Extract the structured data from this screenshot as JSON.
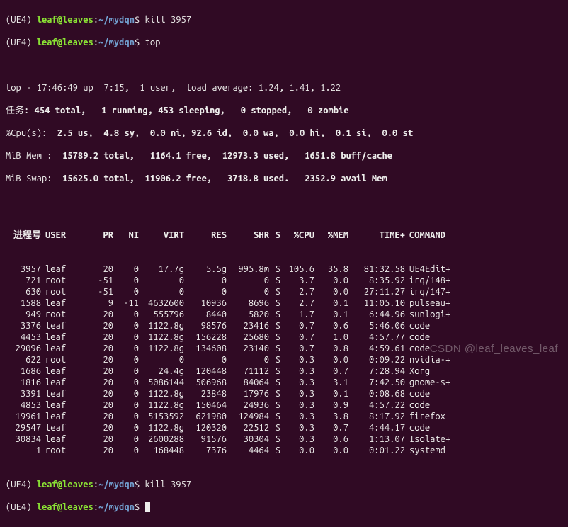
{
  "prompt": {
    "env": "(UE4)",
    "userhost": "leaf@leaves",
    "colon": ":",
    "path": "~/mydqn",
    "dollar": "$"
  },
  "commands": {
    "kill1": "kill 3957",
    "top": "top",
    "kill2": "kill 3957",
    "blank": ""
  },
  "summary": {
    "line1": "top - 17:46:49 up  7:15,  1 user,  load average: 1.24, 1.41, 1.22",
    "tasks_label": "任务:",
    "tasks_rest": " 454 total,   1 running, 453 sleeping,   0 stopped,   0 zombie",
    "cpu_label": "%Cpu(s):",
    "cpu_vals": "  2.5 us,  4.8 sy,  0.0 ni, 92.6 id,  0.0 wa,  0.0 hi,  0.1 si,  0.0 st",
    "mem_label": "MiB Mem :",
    "mem_vals": "  15789.2 total,   1164.1 free,  12973.3 used,   1651.8 buff/cache",
    "swap_label": "MiB Swap:",
    "swap_vals": "  15625.0 total,  11906.2 free,   3718.8 used.   2352.9 avail Mem"
  },
  "columns": {
    "pid": "进程号",
    "user": "USER",
    "pr": "PR",
    "ni": "NI",
    "virt": "VIRT",
    "res": "RES",
    "shr": "SHR",
    "s": "S",
    "cpu": "%CPU",
    "mem": "%MEM",
    "time": "TIME+",
    "cmd": "COMMAND"
  },
  "processes": [
    {
      "pid": "3957",
      "user": "leaf",
      "pr": "20",
      "ni": "0",
      "virt": "17.7g",
      "res": "5.5g",
      "shr": "995.8m",
      "s": "S",
      "cpu": "105.6",
      "mem": "35.8",
      "time": "81:32.58",
      "cmd": "UE4Edit+"
    },
    {
      "pid": "721",
      "user": "root",
      "pr": "-51",
      "ni": "0",
      "virt": "0",
      "res": "0",
      "shr": "0",
      "s": "S",
      "cpu": "3.7",
      "mem": "0.0",
      "time": "8:35.92",
      "cmd": "irq/148+"
    },
    {
      "pid": "630",
      "user": "root",
      "pr": "-51",
      "ni": "0",
      "virt": "0",
      "res": "0",
      "shr": "0",
      "s": "S",
      "cpu": "2.7",
      "mem": "0.0",
      "time": "27:11.27",
      "cmd": "irq/147+"
    },
    {
      "pid": "1588",
      "user": "leaf",
      "pr": "9",
      "ni": "-11",
      "virt": "4632600",
      "res": "10936",
      "shr": "8696",
      "s": "S",
      "cpu": "2.7",
      "mem": "0.1",
      "time": "11:05.10",
      "cmd": "pulseau+"
    },
    {
      "pid": "949",
      "user": "root",
      "pr": "20",
      "ni": "0",
      "virt": "555796",
      "res": "8440",
      "shr": "5820",
      "s": "S",
      "cpu": "1.7",
      "mem": "0.1",
      "time": "6:44.96",
      "cmd": "sunlogi+"
    },
    {
      "pid": "3376",
      "user": "leaf",
      "pr": "20",
      "ni": "0",
      "virt": "1122.8g",
      "res": "98576",
      "shr": "23416",
      "s": "S",
      "cpu": "0.7",
      "mem": "0.6",
      "time": "5:46.06",
      "cmd": "code"
    },
    {
      "pid": "4453",
      "user": "leaf",
      "pr": "20",
      "ni": "0",
      "virt": "1122.8g",
      "res": "156228",
      "shr": "25680",
      "s": "S",
      "cpu": "0.7",
      "mem": "1.0",
      "time": "4:57.77",
      "cmd": "code"
    },
    {
      "pid": "29096",
      "user": "leaf",
      "pr": "20",
      "ni": "0",
      "virt": "1122.8g",
      "res": "134608",
      "shr": "23140",
      "s": "S",
      "cpu": "0.7",
      "mem": "0.8",
      "time": "4:59.61",
      "cmd": "code"
    },
    {
      "pid": "622",
      "user": "root",
      "pr": "20",
      "ni": "0",
      "virt": "0",
      "res": "0",
      "shr": "0",
      "s": "S",
      "cpu": "0.3",
      "mem": "0.0",
      "time": "0:09.22",
      "cmd": "nvidia-+"
    },
    {
      "pid": "1686",
      "user": "leaf",
      "pr": "20",
      "ni": "0",
      "virt": "24.4g",
      "res": "120448",
      "shr": "71112",
      "s": "S",
      "cpu": "0.3",
      "mem": "0.7",
      "time": "7:28.94",
      "cmd": "Xorg"
    },
    {
      "pid": "1816",
      "user": "leaf",
      "pr": "20",
      "ni": "0",
      "virt": "5086144",
      "res": "506968",
      "shr": "84064",
      "s": "S",
      "cpu": "0.3",
      "mem": "3.1",
      "time": "7:42.50",
      "cmd": "gnome-s+"
    },
    {
      "pid": "3391",
      "user": "leaf",
      "pr": "20",
      "ni": "0",
      "virt": "1122.8g",
      "res": "23848",
      "shr": "17976",
      "s": "S",
      "cpu": "0.3",
      "mem": "0.1",
      "time": "0:08.68",
      "cmd": "code"
    },
    {
      "pid": "4853",
      "user": "leaf",
      "pr": "20",
      "ni": "0",
      "virt": "1122.8g",
      "res": "150464",
      "shr": "24936",
      "s": "S",
      "cpu": "0.3",
      "mem": "0.9",
      "time": "4:57.22",
      "cmd": "code"
    },
    {
      "pid": "19961",
      "user": "leaf",
      "pr": "20",
      "ni": "0",
      "virt": "5153592",
      "res": "621980",
      "shr": "124984",
      "s": "S",
      "cpu": "0.3",
      "mem": "3.8",
      "time": "8:17.92",
      "cmd": "firefox"
    },
    {
      "pid": "29547",
      "user": "leaf",
      "pr": "20",
      "ni": "0",
      "virt": "1122.8g",
      "res": "120320",
      "shr": "22512",
      "s": "S",
      "cpu": "0.3",
      "mem": "0.7",
      "time": "4:44.17",
      "cmd": "code"
    },
    {
      "pid": "30834",
      "user": "leaf",
      "pr": "20",
      "ni": "0",
      "virt": "2600288",
      "res": "91576",
      "shr": "30304",
      "s": "S",
      "cpu": "0.3",
      "mem": "0.6",
      "time": "1:13.07",
      "cmd": "Isolate+"
    },
    {
      "pid": "1",
      "user": "root",
      "pr": "20",
      "ni": "0",
      "virt": "168448",
      "res": "7376",
      "shr": "4464",
      "s": "S",
      "cpu": "0.0",
      "mem": "0.0",
      "time": "0:01.22",
      "cmd": "systemd"
    }
  ],
  "watermark": "CSDN @leaf_leaves_leaf"
}
